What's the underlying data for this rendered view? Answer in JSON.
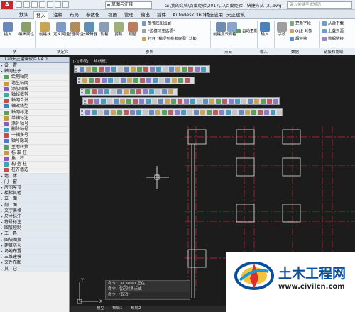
{
  "app": {
    "logo_letter": "A",
    "workspace": "草图与注释",
    "window_title": "G:\\我的文档\\百度经验\\2017\\...\\百度经验 - 快捷方式 (2).dwg",
    "search_placeholder": "键入关键字或短语"
  },
  "tabs": [
    "默认",
    "插入",
    "注释",
    "布局",
    "参数化",
    "视图",
    "管理",
    "输出",
    "插件",
    "Autodesk 360",
    "精选应用",
    "天正建筑"
  ],
  "active_tab": "插入",
  "ribbon": {
    "big": [
      "插入",
      "编辑属性",
      "创建块",
      "定义属性",
      "管理属性",
      "块编辑器",
      "附着",
      "剪裁",
      "调整",
      "创建点云",
      "附着",
      "输入",
      "字段"
    ],
    "small": {
      "ref1": "参考底图图层",
      "ref2": "*边框可变选项*",
      "ref3": "打开 \"捕捉到参考底图\" 功能",
      "pc1": "自动更新",
      "data1": "更新字段",
      "data2": "OLE 对象",
      "data3": "超链接",
      "link1": "从源下载",
      "link2": "上载到源",
      "link3": "数据链接"
    },
    "panels": [
      "块",
      "块定义",
      "参照",
      "点云",
      "输入",
      "数据",
      "链接和提取"
    ]
  },
  "sidebar": {
    "title": "T20天正建筑软件 V4.0",
    "items": [
      {
        "label": "设　置",
        "cat": true
      },
      {
        "label": "轴网柱子",
        "cat": true
      },
      {
        "label": "绘制轴网"
      },
      {
        "label": "墙生轴网"
      },
      {
        "label": "添加轴线"
      },
      {
        "label": "轴线裁剪"
      },
      {
        "label": "轴网合并"
      },
      {
        "label": "轴改线型"
      },
      {
        "label": "轴网标注"
      },
      {
        "label": "单轴标注"
      },
      {
        "label": "添补轴号"
      },
      {
        "label": "删除轴号"
      },
      {
        "label": "一轴多号"
      },
      {
        "label": "轴号隐现"
      },
      {
        "label": "主附转换"
      },
      {
        "label": "标 准 柱"
      },
      {
        "label": "角　柱"
      },
      {
        "label": "构 造 柱"
      },
      {
        "label": "柱齐墙边"
      },
      {
        "label": "墙　体",
        "cat": true
      },
      {
        "label": "门　窗",
        "cat": true
      },
      {
        "label": "房间屋顶",
        "cat": true
      },
      {
        "label": "楼梯其他",
        "cat": true
      },
      {
        "label": "立　面",
        "cat": true
      },
      {
        "label": "剖　面",
        "cat": true
      },
      {
        "label": "文字表格",
        "cat": true
      },
      {
        "label": "尺寸标注",
        "cat": true
      },
      {
        "label": "符号标注",
        "cat": true
      },
      {
        "label": "图层控制",
        "cat": true
      },
      {
        "label": "工　具",
        "cat": true
      },
      {
        "label": "图块图案",
        "cat": true
      },
      {
        "label": "建筑防火",
        "cat": true
      },
      {
        "label": "场地布置",
        "cat": true
      },
      {
        "label": "三维建模",
        "cat": true
      },
      {
        "label": "文件布图",
        "cat": true
      },
      {
        "label": "其　它",
        "cat": true
      }
    ]
  },
  "viewport_label": "[-][俯视][二维线框]",
  "command": {
    "line1": "命令: _ai_selall 正在...",
    "line2": "命令: 指定对角点或",
    "line3": "命令: *取消*",
    "input": "键入命令"
  },
  "model_tabs": [
    "模型",
    "布局1",
    "布局2"
  ],
  "watermark": {
    "name": "土木工程网",
    "url": "www.civilcn.com"
  },
  "colors": {
    "accent": "#c7262c",
    "grid": "#cc2a3a",
    "wall": "#e6e6e6",
    "logo_blue": "#0a4e9b"
  }
}
